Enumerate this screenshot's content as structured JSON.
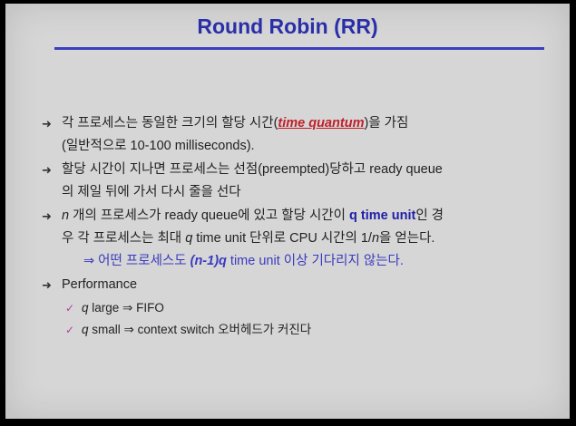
{
  "slide": {
    "title": "Round Robin (RR)",
    "b1_l1_pre": "각 프로세스는 동일한 크기의 할당 시간(",
    "b1_l1_hl": "time quantum",
    "b1_l1_post": ")을 가짐",
    "b1_l2": "(일반적으로 10-100 milliseconds).",
    "b2_l1": "할당 시간이 지나면 프로세스는 선점(preempted)당하고 ready queue",
    "b2_l2": "의 제일 뒤에 가서 다시 줄을 선다",
    "b3_l1_n": "n",
    "b3_l1_pre": " 개의 프로세스가 ready queue에 있고 할당 시간이 ",
    "b3_l1_hl": "q time unit",
    "b3_l1_post": "인 경",
    "b3_l2_pre": "우 각 프로세스는 최대 ",
    "b3_l2_q": "q",
    "b3_l2_mid": " time unit 단위로 CPU 시간의 1/",
    "b3_l2_n": "n",
    "b3_l2_post": "을 얻는다.",
    "b3_sub_arrow": "⇒",
    "b3_sub_pre": " 어떤 프로세스도 ",
    "b3_sub_it": "(n-1)q",
    "b3_sub_post": " time unit 이상 기다리지 않는다.",
    "b4": "Performance",
    "c1_q": "q",
    "c1_rest": " large ⇒ FIFO",
    "c2_q": "q",
    "c2_rest": " small ⇒ context switch 오버헤드가 커진다",
    "bullet_glyph": "➜",
    "check_glyph": "✓"
  }
}
